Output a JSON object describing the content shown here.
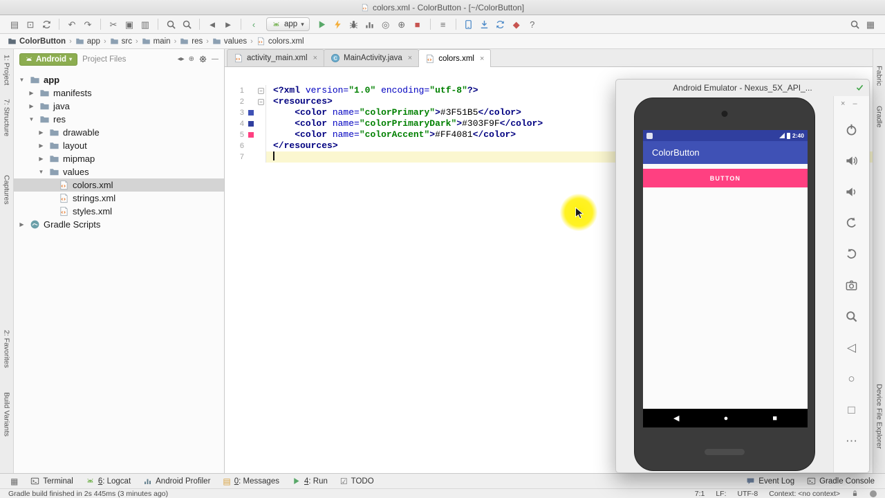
{
  "titlebar": {
    "title": "colors.xml - ColorButton - [~/ColorButton]"
  },
  "toolbar": {
    "run_config_label": "app",
    "items": [
      {
        "name": "open-icon",
        "glyph": "▤"
      },
      {
        "name": "save-all-icon",
        "glyph": "⊡"
      },
      {
        "name": "sync-icon",
        "svg": "i-sync"
      },
      {
        "sep": true
      },
      {
        "name": "undo-icon",
        "glyph": "↶"
      },
      {
        "name": "redo-icon",
        "glyph": "↷"
      },
      {
        "sep": true
      },
      {
        "name": "cut-icon",
        "glyph": "✂"
      },
      {
        "name": "copy-icon",
        "glyph": "▣"
      },
      {
        "name": "paste-icon",
        "glyph": "▥"
      },
      {
        "sep": true
      },
      {
        "name": "find-icon",
        "svg": "i-magnifier"
      },
      {
        "name": "replace-icon",
        "svg": "i-magnifier"
      },
      {
        "sep": true
      },
      {
        "name": "back-icon",
        "glyph": "◄"
      },
      {
        "name": "forward-icon",
        "glyph": "►"
      },
      {
        "sep": true
      },
      {
        "name": "navigate-back-icon",
        "glyph": "‹",
        "color": "#59A869"
      },
      {
        "runconfig": true
      },
      {
        "name": "run-icon",
        "svg": "i-play",
        "color": "#59A869"
      },
      {
        "name": "apply-changes-icon",
        "svg": "i-lightning",
        "color": "#F4AF3D"
      },
      {
        "name": "debug-icon",
        "svg": "i-bug",
        "color": "#6E6E6E"
      },
      {
        "name": "profiler-icon",
        "svg": "i-chart",
        "color": "#6E6E6E"
      },
      {
        "name": "coverage-icon",
        "glyph": "◎"
      },
      {
        "name": "attach-debugger-icon",
        "glyph": "⊕"
      },
      {
        "name": "stop-icon",
        "glyph": "■",
        "color": "#C75450"
      },
      {
        "sep": true
      },
      {
        "name": "tool-windows-icon",
        "glyph": "≡"
      },
      {
        "sep": true
      },
      {
        "name": "avd-manager-icon",
        "svg": "i-phone",
        "color": "#4A88C7"
      },
      {
        "name": "sdk-manager-icon",
        "svg": "i-download",
        "color": "#4A88C7"
      },
      {
        "name": "gradle-sync-icon",
        "svg": "i-sync",
        "color": "#4A88C7"
      },
      {
        "name": "firebase-icon",
        "glyph": "◆",
        "color": "#C75450"
      },
      {
        "name": "help-icon",
        "glyph": "?"
      },
      {
        "spacer": true
      },
      {
        "name": "search-everywhere-icon",
        "svg": "i-magnifier"
      },
      {
        "name": "tool-window-quick-access-icon",
        "glyph": "▦"
      }
    ]
  },
  "breadcrumb": {
    "items": [
      {
        "label": "ColorButton",
        "icon": "module",
        "bold": true
      },
      {
        "label": "app",
        "icon": "folder"
      },
      {
        "label": "src",
        "icon": "folder"
      },
      {
        "label": "main",
        "icon": "folder"
      },
      {
        "label": "res",
        "icon": "folder"
      },
      {
        "label": "values",
        "icon": "folder"
      },
      {
        "label": "colors.xml",
        "icon": "file"
      }
    ]
  },
  "left_strip": {
    "items": [
      "1: Project",
      "7: Structure",
      "Captures",
      "2: Favorites",
      "Build Variants"
    ]
  },
  "right_strip": {
    "items": [
      "Fabric",
      "Gradle",
      "Device File Explorer"
    ]
  },
  "project_panel": {
    "selector": {
      "label": "Android",
      "secondary": "Project Files"
    },
    "header_icons": [
      {
        "name": "scroll-to-source-icon",
        "glyph": "◂▸"
      },
      {
        "name": "locate-icon",
        "glyph": "⊕"
      },
      {
        "name": "settings-icon",
        "svg": "i-gear"
      },
      {
        "name": "hide-panel-icon",
        "glyph": "—"
      }
    ],
    "tree": [
      {
        "label": "app",
        "level": 0,
        "icon": "folder",
        "arrow": "open",
        "bold": true
      },
      {
        "label": "manifests",
        "level": 1,
        "icon": "folder",
        "arrow": "closed"
      },
      {
        "label": "java",
        "level": 1,
        "icon": "folder",
        "arrow": "closed"
      },
      {
        "label": "res",
        "level": 1,
        "icon": "folder",
        "arrow": "open"
      },
      {
        "label": "drawable",
        "level": 2,
        "icon": "folder",
        "arrow": "closed"
      },
      {
        "label": "layout",
        "level": 2,
        "icon": "folder",
        "arrow": "closed"
      },
      {
        "label": "mipmap",
        "level": 2,
        "icon": "folder",
        "arrow": "closed"
      },
      {
        "label": "values",
        "level": 2,
        "icon": "folder",
        "arrow": "open"
      },
      {
        "label": "colors.xml",
        "level": 3,
        "icon": "xml",
        "selected": true
      },
      {
        "label": "strings.xml",
        "level": 3,
        "icon": "xml"
      },
      {
        "label": "styles.xml",
        "level": 3,
        "icon": "xml"
      },
      {
        "label": "Gradle Scripts",
        "level": 0,
        "icon": "gradle",
        "arrow": "closed"
      }
    ]
  },
  "editor": {
    "tabs": [
      {
        "label": "activity_main.xml",
        "icon": "xml",
        "active": false
      },
      {
        "label": "MainActivity.java",
        "icon": "class",
        "active": false
      },
      {
        "label": "colors.xml",
        "icon": "xml",
        "active": true
      }
    ],
    "syntax_colors": {
      "tag": "#000080",
      "attr": "#0000C0",
      "str": "#008000",
      "plain": "#000000",
      "caret_line": "#FBF7D0"
    },
    "lines": [
      {
        "num": 1,
        "fold": true,
        "tokens": [
          [
            "<?xml ",
            "tag"
          ],
          [
            "version",
            "attr"
          ],
          [
            "=",
            "attr"
          ],
          [
            "\"1.0\"",
            "str"
          ],
          [
            " ",
            "plain"
          ],
          [
            "encoding",
            "attr"
          ],
          [
            "=",
            "attr"
          ],
          [
            "\"utf-8\"",
            "str"
          ],
          [
            "?>",
            "tag"
          ]
        ]
      },
      {
        "num": 2,
        "fold": true,
        "tokens": [
          [
            "<resources>",
            "tag"
          ]
        ]
      },
      {
        "num": 3,
        "swatch": "#3F51B5",
        "tokens": [
          [
            "    ",
            "plain"
          ],
          [
            "<color ",
            "tag"
          ],
          [
            "name",
            "attr"
          ],
          [
            "=",
            "attr"
          ],
          [
            "\"colorPrimary\"",
            "str"
          ],
          [
            ">",
            "tag"
          ],
          [
            "#3F51B5",
            "plain"
          ],
          [
            "</color>",
            "tag"
          ]
        ]
      },
      {
        "num": 4,
        "swatch": "#303F9F",
        "tokens": [
          [
            "    ",
            "plain"
          ],
          [
            "<color ",
            "tag"
          ],
          [
            "name",
            "attr"
          ],
          [
            "=",
            "attr"
          ],
          [
            "\"colorPrimaryDark\"",
            "str"
          ],
          [
            ">",
            "tag"
          ],
          [
            "#303F9F",
            "plain"
          ],
          [
            "</color>",
            "tag"
          ]
        ]
      },
      {
        "num": 5,
        "swatch": "#FF4081",
        "tokens": [
          [
            "    ",
            "plain"
          ],
          [
            "<color ",
            "tag"
          ],
          [
            "name",
            "attr"
          ],
          [
            "=",
            "attr"
          ],
          [
            "\"colorAccent\"",
            "str"
          ],
          [
            ">",
            "tag"
          ],
          [
            "#FF4081",
            "plain"
          ],
          [
            "</color>",
            "tag"
          ]
        ]
      },
      {
        "num": 6,
        "tokens": [
          [
            "</resources>",
            "tag"
          ]
        ]
      },
      {
        "num": 7,
        "caret": true,
        "tokens": []
      }
    ]
  },
  "emulator": {
    "title": "Android Emulator - Nexus_5X_API_...",
    "window_controls": [
      {
        "name": "close-emulator-icon",
        "glyph": "×"
      },
      {
        "name": "minimize-emulator-icon",
        "glyph": "–"
      }
    ],
    "side_icons": [
      {
        "name": "power-icon",
        "svg": "i-power"
      },
      {
        "name": "volume-up-icon",
        "svg": "i-volup"
      },
      {
        "name": "volume-down-icon",
        "svg": "i-voldn"
      },
      {
        "name": "rotate-left-icon",
        "svg": "i-rotl"
      },
      {
        "name": "rotate-right-icon",
        "svg": "i-rotr"
      },
      {
        "name": "screenshot-icon",
        "svg": "i-camera"
      },
      {
        "name": "zoom-icon",
        "svg": "i-magnifier"
      },
      {
        "name": "back-icon",
        "glyph": "◁"
      },
      {
        "name": "home-icon",
        "glyph": "○"
      },
      {
        "name": "overview-icon",
        "glyph": "□"
      },
      {
        "name": "more-icon",
        "glyph": "⋯"
      }
    ],
    "phone": {
      "status_time": "2:40",
      "app_title": "ColorButton",
      "button_label": "BUTTON",
      "colors": {
        "status_bar": "#303F9F",
        "app_bar": "#3F51B5",
        "button": "#FF4081"
      }
    }
  },
  "bottom_bar": {
    "left": [
      {
        "name": "tool-window-switcher",
        "icon": {
          "glyph": "▦"
        },
        "label": ""
      },
      {
        "name": "terminal",
        "icon": {
          "svg": "i-terminal",
          "color": "#5E5E5E"
        },
        "label": "Terminal"
      },
      {
        "name": "logcat",
        "icon": {
          "svg": "i-droid",
          "color": "#77B255"
        },
        "mnemonic": "6",
        "label": "Logcat"
      },
      {
        "name": "android-profiler",
        "icon": {
          "svg": "i-chart",
          "color": "#607D8B"
        },
        "label": "Android Profiler"
      },
      {
        "name": "messages",
        "icon": {
          "glyph": "▤",
          "color": "#D9A343"
        },
        "mnemonic": "0",
        "label": "Messages"
      },
      {
        "name": "run",
        "icon": {
          "svg": "i-play",
          "color": "#59A869"
        },
        "mnemonic": "4",
        "label": "Run"
      },
      {
        "name": "todo",
        "icon": {
          "glyph": "☑",
          "color": "#6E6E6E"
        },
        "label": "TODO"
      }
    ],
    "right": [
      {
        "name": "event-log",
        "icon": {
          "svg": "i-chat",
          "color": "#6E82A0"
        },
        "label": "Event Log"
      },
      {
        "name": "gradle-console",
        "icon": {
          "svg": "i-terminal",
          "color": "#6E6E6E"
        },
        "label": "Gradle Console"
      }
    ]
  },
  "status_bar": {
    "message": "Gradle build finished in 2s 445ms (3 minutes ago)",
    "position": "7:1",
    "line_sep": "LF:",
    "encoding": "UTF-8",
    "context": "Context: <no context>"
  }
}
